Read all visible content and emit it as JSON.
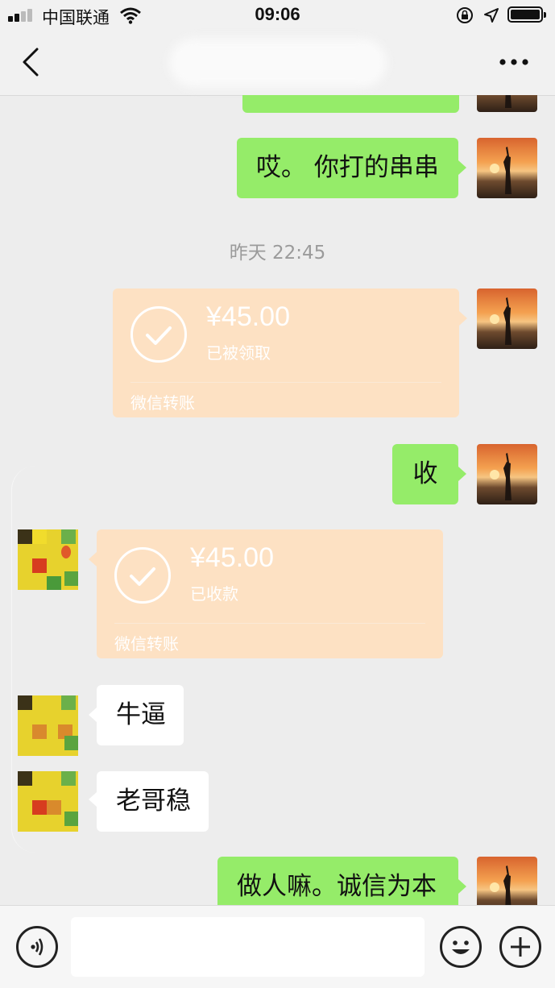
{
  "status_bar": {
    "carrier": "中国联通",
    "time": "09:06"
  },
  "nav_bar": {
    "back_icon": "chevron-left-icon",
    "more_icon": "more-dots-icon"
  },
  "messages": [
    {
      "type": "text",
      "side": "right",
      "text": "哎。 你打的串串"
    },
    {
      "type": "timestamp",
      "text": "昨天 22:45"
    },
    {
      "type": "transfer",
      "side": "right",
      "amount": "¥45.00",
      "status": "已被领取",
      "label": "微信转账"
    },
    {
      "type": "text",
      "side": "right",
      "text": "收"
    },
    {
      "type": "transfer",
      "side": "left",
      "amount": "¥45.00",
      "status": "已收款",
      "label": "微信转账"
    },
    {
      "type": "text",
      "side": "left",
      "text": "牛逼"
    },
    {
      "type": "text",
      "side": "left",
      "text": "老哥稳"
    },
    {
      "type": "text",
      "side": "right",
      "text": "做人嘛。诚信为本"
    }
  ],
  "input_bar": {
    "voice_icon": "voice-icon",
    "emoji_icon": "emoji-icon",
    "plus_icon": "plus-icon"
  },
  "colors": {
    "self_bubble": "#95ec69",
    "other_bubble": "#ffffff",
    "transfer_bubble": "#fde1c3",
    "background": "#ededed"
  }
}
